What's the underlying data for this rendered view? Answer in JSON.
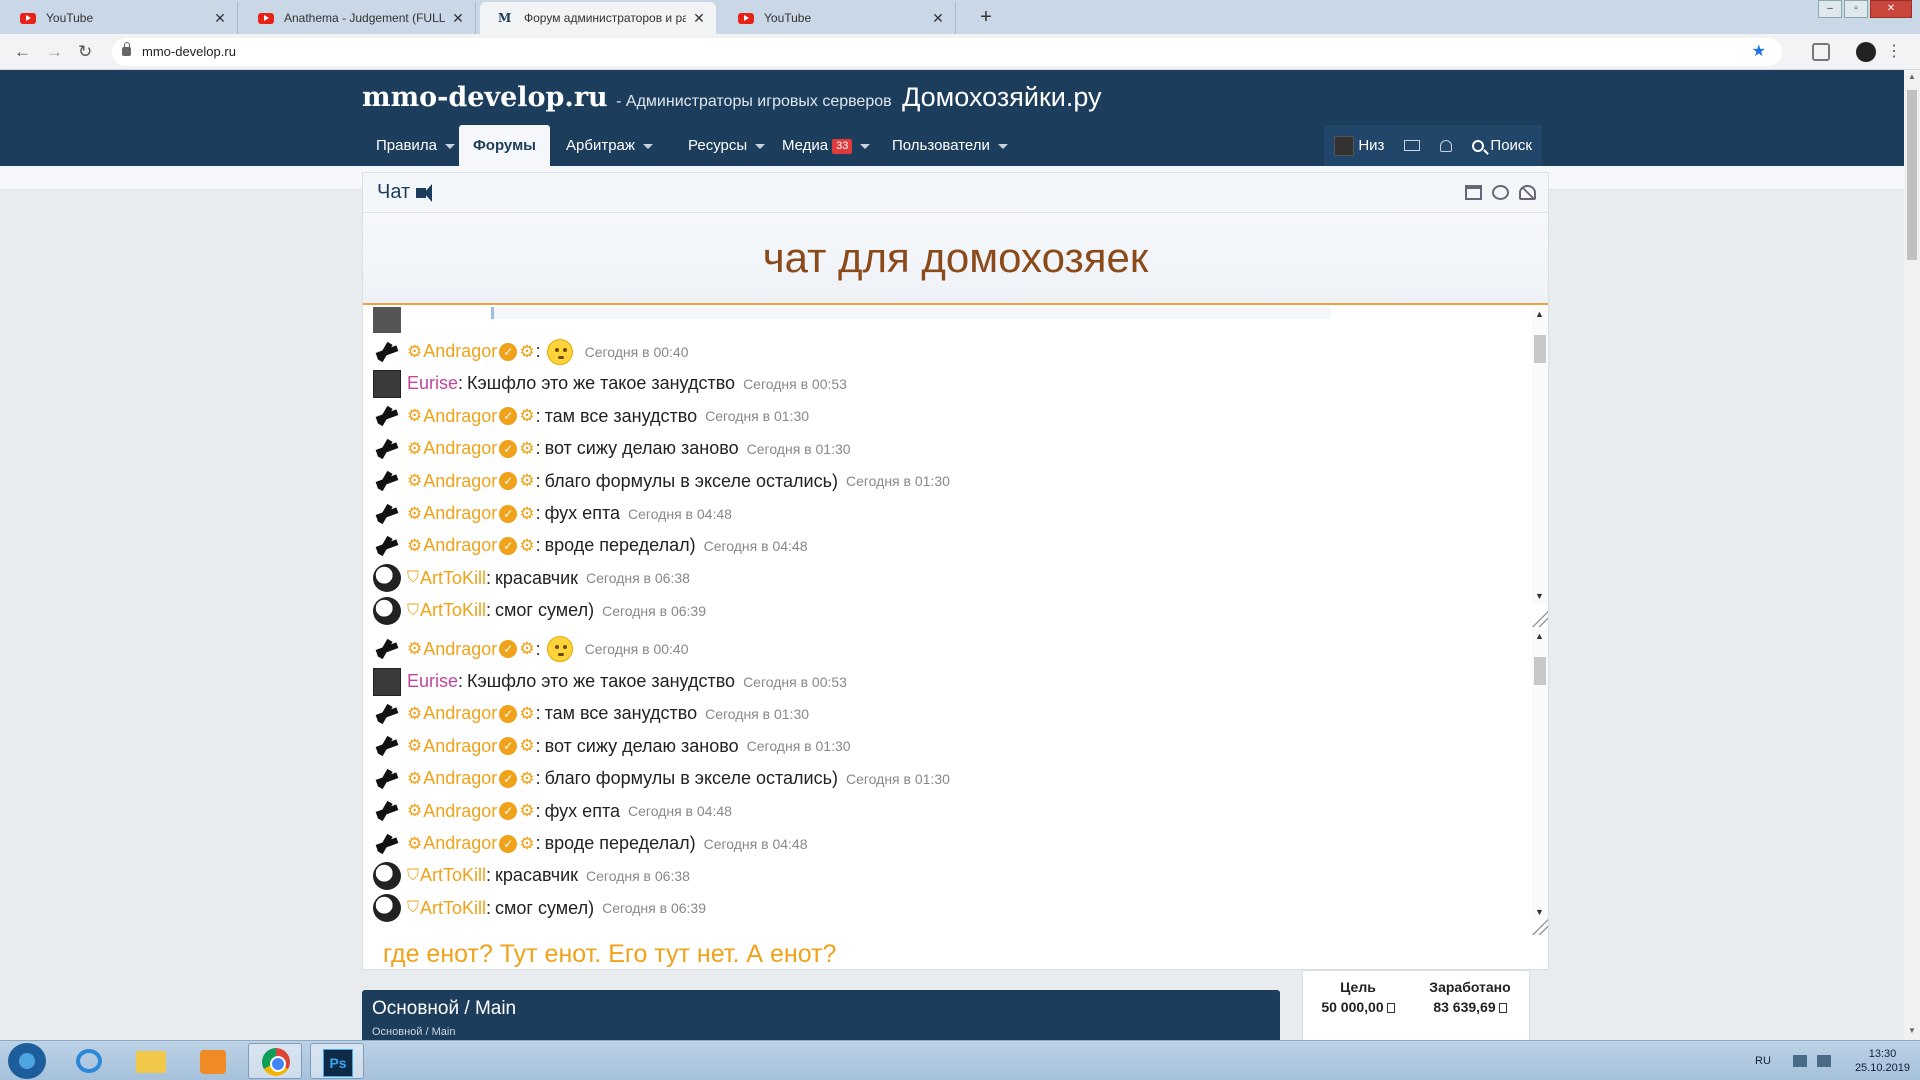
{
  "browser": {
    "tabs": [
      {
        "title": "YouTube",
        "icon": "youtube-icon"
      },
      {
        "title": "Anathema - Judgement (FULL AL",
        "icon": "youtube-icon"
      },
      {
        "title": "Форум администраторов и раз",
        "icon": "forum-icon",
        "active": true
      },
      {
        "title": "YouTube",
        "icon": "youtube-icon"
      }
    ],
    "url": "mmo-develop.ru"
  },
  "site": {
    "brand": "mmo-develop.ru",
    "tagline": "- Администраторы игровых серверов",
    "slogan": "Домохозяйки.ру",
    "nav": [
      {
        "label": "Правила",
        "dropdown": true
      },
      {
        "label": "Форумы",
        "active": true
      },
      {
        "label": "Арбитраж",
        "dropdown": true
      },
      {
        "label": "Ресурсы",
        "dropdown": true
      },
      {
        "label": "Медиа",
        "badge": "33",
        "dropdown": true
      },
      {
        "label": "Пользователи",
        "dropdown": true
      }
    ],
    "nav_right": {
      "user": "Низ",
      "search": "Поиск"
    }
  },
  "chat": {
    "title": "Чат",
    "banner": "чат для домохозяек",
    "messages": [
      {
        "user": "Andragor",
        "text": "",
        "emoji": true,
        "time": "Сегодня в 00:40"
      },
      {
        "user": "Eurise",
        "text": "Кэшфло это же такое занудство",
        "time": "Сегодня в 00:53"
      },
      {
        "user": "Andragor",
        "text": "там все занудство",
        "time": "Сегодня в 01:30"
      },
      {
        "user": "Andragor",
        "text": "вот сижу делаю заново",
        "time": "Сегодня в 01:30"
      },
      {
        "user": "Andragor",
        "text": "благо формулы в экселе остались)",
        "time": "Сегодня в 01:30"
      },
      {
        "user": "Andragor",
        "text": "фух епта",
        "time": "Сегодня в 04:48"
      },
      {
        "user": "Andragor",
        "text": "вроде переделал)",
        "time": "Сегодня в 04:48"
      },
      {
        "user": "ArtToKill",
        "text": "красавчик",
        "time": "Сегодня в 06:38"
      },
      {
        "user": "ArtToKill",
        "text": "смог сумел)",
        "time": "Сегодня в 06:39"
      }
    ],
    "footer": "где енот? Тут енот. Его тут нет. А енот?"
  },
  "main": {
    "title": "Основной / Main",
    "breadcrumb": "Основной / Main"
  },
  "goal": {
    "target_label": "Цель",
    "target_value": "50 000,00",
    "earned_label": "Заработано",
    "earned_value": "83 639,69"
  },
  "taskbar": {
    "lang": "RU",
    "time": "13:30",
    "date": "25.10.2019"
  },
  "colors": {
    "header": "#1c3d5c",
    "accent": "#f0a21a",
    "eurise": "#c2449e",
    "banner_text": "#8b4a1a"
  }
}
